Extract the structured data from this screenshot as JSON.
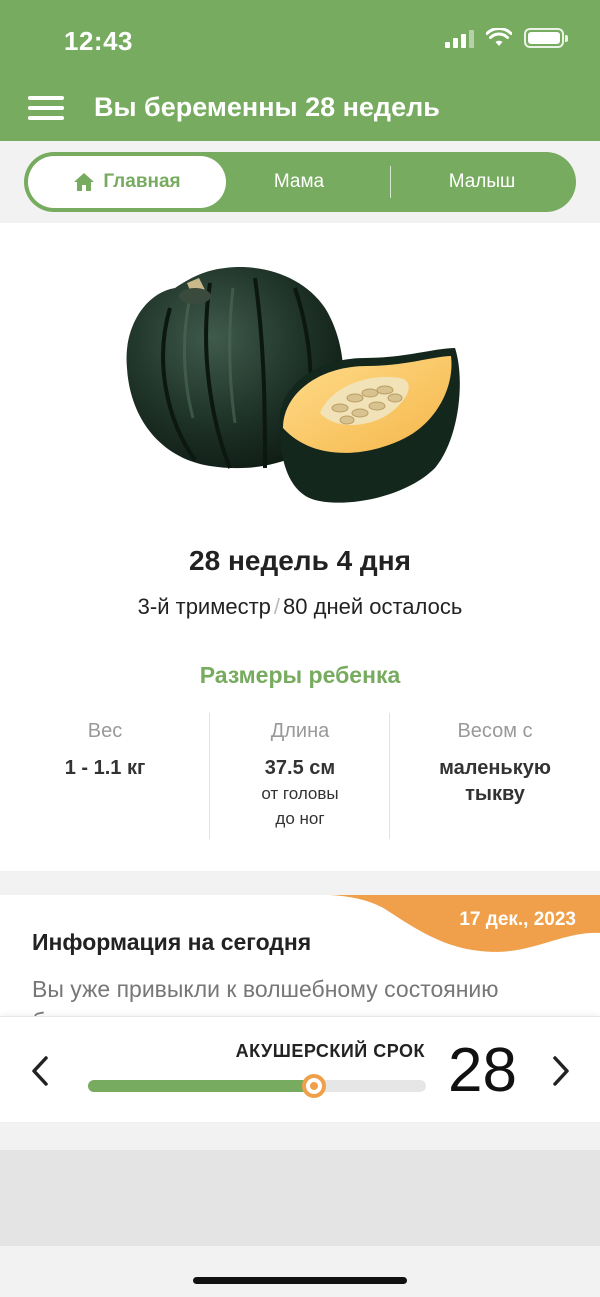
{
  "status": {
    "time": "12:43"
  },
  "header": {
    "title": "Вы беременны 28 недель",
    "menu_icon": "hamburger-menu-icon"
  },
  "tabs": [
    {
      "label": "Главная",
      "active": true,
      "icon": "home-icon"
    },
    {
      "label": "Мама",
      "active": false
    },
    {
      "label": "Малыш",
      "active": false
    }
  ],
  "colors": {
    "brand_green": "#77ab5f",
    "accent_orange": "#f0a04b"
  },
  "pregnancy": {
    "image": "acorn-squash-image",
    "weeks_label": "28 недель 4 дня",
    "trimester": "3-й триместр",
    "separator": "/",
    "days_left": "80 дней осталось"
  },
  "baby_size": {
    "title": "Размеры ребенка",
    "weight": {
      "label": "Вес",
      "value": "1 - 1.1 кг"
    },
    "length": {
      "label": "Длина",
      "value": "37.5 см",
      "sub1": "от головы",
      "sub2": "до ног"
    },
    "compare": {
      "label": "Весом с",
      "value1": "маленькую",
      "value2": "тыкву"
    }
  },
  "info": {
    "date": "17 дек., 2023",
    "title": "Информация на сегодня",
    "body": "Вы уже привыкли к волшебному состоянию беременности, и ваше внимание"
  },
  "term": {
    "label": "АКУШЕРСКИЙ СРОК",
    "week": "28",
    "progress": 0.67
  }
}
